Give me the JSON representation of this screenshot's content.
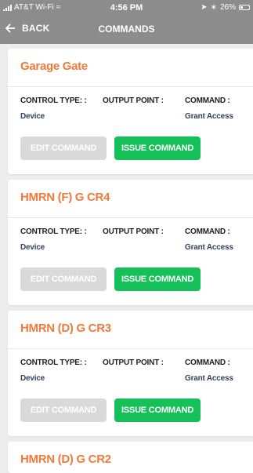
{
  "status_bar": {
    "carrier": "AT&T Wi-Fi",
    "time": "4:56 PM",
    "battery": "26%"
  },
  "nav": {
    "back_label": "BACK",
    "title": "COMMANDS"
  },
  "labels": {
    "control_type": "CONTROL TYPE: :",
    "output_point": "OUTPUT POINT :",
    "command": "COMMAND :",
    "edit_button": "EDIT COMMAND",
    "issue_button": "ISSUE COMMAND"
  },
  "commands": [
    {
      "name": "Garage Gate",
      "control_type": "Device",
      "output_point": "",
      "command": "Grant Access"
    },
    {
      "name": "HMRN (F) G CR4",
      "control_type": "Device",
      "output_point": "",
      "command": "Grant Access"
    },
    {
      "name": "HMRN (D) G CR3",
      "control_type": "Device",
      "output_point": "",
      "command": "Grant Access"
    },
    {
      "name": "HMRN (D) G CR2"
    }
  ],
  "colors": {
    "title_orange": "#f07a3c",
    "issue_green": "#14c057",
    "edit_disabled": "#d9d9d9",
    "header_gray": "#8c8c8c"
  }
}
